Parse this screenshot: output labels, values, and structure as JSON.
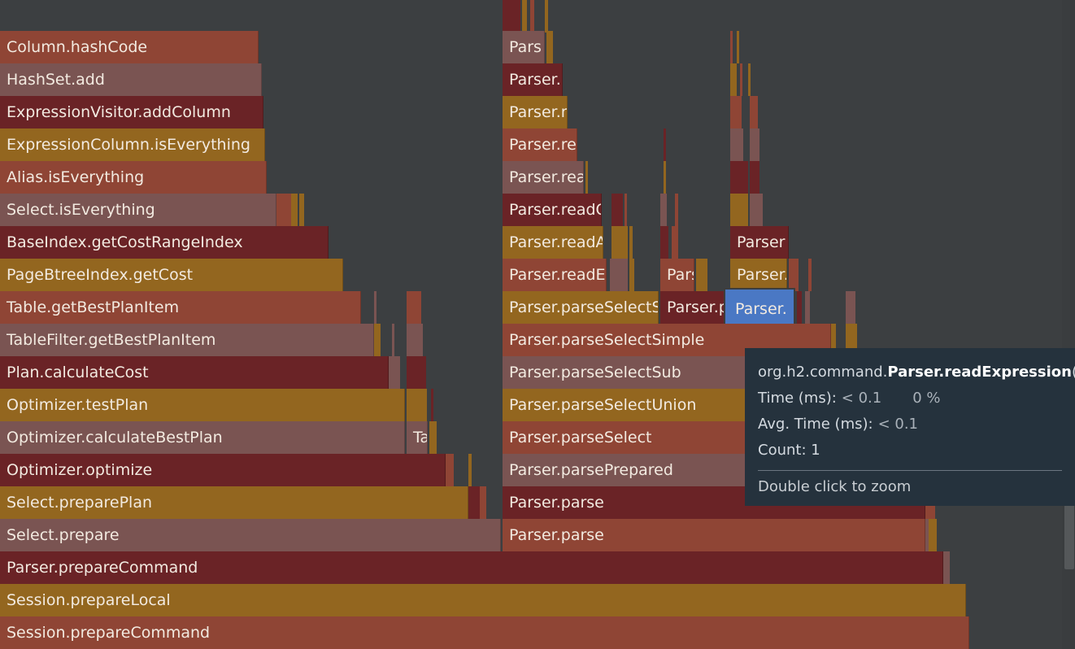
{
  "colors": {
    "background": "#3c3f41",
    "dark_red": "#6a2326",
    "orange": "#8f4535",
    "mauve": "#7a5452",
    "gold": "#93661f",
    "selected": "#4a78c4",
    "tooltip_bg": "#25323d"
  },
  "frames": {
    "column_hashcode": "Column.hashCode",
    "hashset_add": "HashSet.add",
    "expressionvisitor_addcolumn": "ExpressionVisitor.addColumn",
    "expressioncolumn_iseverything": "ExpressionColumn.isEverything",
    "alias_iseverything": "Alias.isEverything",
    "select_iseverything": "Select.isEverything",
    "baseindex_getcostrangeindex": "BaseIndex.getCostRangeIndex",
    "pagebtreeindex_getcost": "PageBtreeIndex.getCost",
    "table_getbestplanitem": "Table.getBestPlanItem",
    "tablefilter_getbestplanitem": "TableFilter.getBestPlanItem",
    "plan_calculatecost": "Plan.calculateCost",
    "optimizer_testplan": "Optimizer.testPlan",
    "optimizer_calculatebestplan": "Optimizer.calculateBestPlan",
    "ta_truncated": "Ta",
    "optimizer_optimize": "Optimizer.optimize",
    "select_prepareplan": "Select.preparePlan",
    "select_prepare": "Select.prepare",
    "parser_preparecommand": "Parser.prepareCommand",
    "session_preparelocal": "Session.prepareLocal",
    "session_preparecommand": "Session.prepareCommand",
    "pars_a": "Pars",
    "parser_dot": "Parser.",
    "parser_r": "Parser.r",
    "parser_re": "Parser.re",
    "parser_rea": "Parser.rea",
    "parser_readc": "Parser.readC",
    "parser_readar": "Parser.readAr",
    "parser_readexp": "Parser.readExp",
    "pars_b": "Pars",
    "parser_parseselectsir": "Parser.parseSelectSir",
    "parser_p": "Parser.p",
    "parser_c": "Parser",
    "parser_d": "Parser.",
    "parser_selected": "Parser.",
    "parser_parseselectsimple": "Parser.parseSelectSimple",
    "parser_parseselectsub": "Parser.parseSelectSub",
    "parser_parseselectunion": "Parser.parseSelectUnion",
    "parser_parseselect": "Parser.parseSelect",
    "parser_parseprepared": "Parser.parsePrepared",
    "parser_parse_1": "Parser.parse",
    "parser_parse_2": "Parser.parse"
  },
  "tooltip": {
    "package": "org.h2.command.",
    "method": "Parser.readExpression",
    "parens": "()",
    "time_label": "Time (ms):",
    "time_value": "< 0.1",
    "time_percent": "0 %",
    "avg_label": "Avg. Time (ms):",
    "avg_value": "< 0.1",
    "count_label": "Count:",
    "count_value": "1",
    "hint": "Double click to zoom"
  }
}
